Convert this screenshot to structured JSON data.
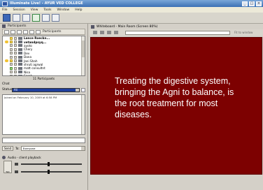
{
  "window": {
    "title": "Illuminate Live! - AYUR VED COLLEGE",
    "buttons": [
      "_",
      "□",
      "×"
    ]
  },
  "menu": [
    "File",
    "Session",
    "View",
    "Tools",
    "Window",
    "Help"
  ],
  "participants": {
    "section_title": "Participants",
    "toolbar_label": "Participants",
    "items": [
      {
        "name": "Lance Roeckn...",
        "bold": true,
        "hand": false,
        "mic": "yellow"
      },
      {
        "name": "vetandpsyq...",
        "bold": true,
        "hand": true,
        "mic": "yellow"
      },
      {
        "name": "ayoto",
        "bold": false,
        "hand": false,
        "mic": "grey"
      },
      {
        "name": "Chery",
        "bold": false,
        "hand": false,
        "mic": "grey"
      },
      {
        "name": "Dev",
        "bold": false,
        "hand": false,
        "mic": "grey"
      },
      {
        "name": "Dana",
        "bold": false,
        "hand": false,
        "mic": "grey"
      },
      {
        "name": "Jani Shah",
        "bold": false,
        "hand": true,
        "mic": "yellow"
      },
      {
        "name": "shruti agrwal",
        "bold": false,
        "hand": false,
        "mic": "grey"
      },
      {
        "name": "matt consultnt",
        "bold": false,
        "hand": false,
        "mic": "green"
      },
      {
        "name": "Nisa",
        "bold": false,
        "hand": false,
        "mic": "grey"
      },
      {
        "name": "Sarah",
        "bold": false,
        "hand": false,
        "mic": "grey"
      }
    ],
    "count_text": "11 Participants"
  },
  "chat": {
    "title": "Chat",
    "status_label": "Status",
    "status_value": "Ali",
    "log": "Joined on February 10, 2009 at 6:58 PM",
    "send_label": "Send",
    "to_label": "To:",
    "to_value": "Everyone"
  },
  "audio": {
    "title": "Audio - client playback",
    "talk_label": "Talk",
    "volume_level": 0.45,
    "mic_level": 0.45
  },
  "whiteboard": {
    "title": "Whiteboard - Main Room (Screen 80%)",
    "fit_label": "Fit to window",
    "slide_text": "Treating the digestive system, bringing the Agni to balance, is the root treatment for most diseases.",
    "slide_color": "#7d0101"
  }
}
